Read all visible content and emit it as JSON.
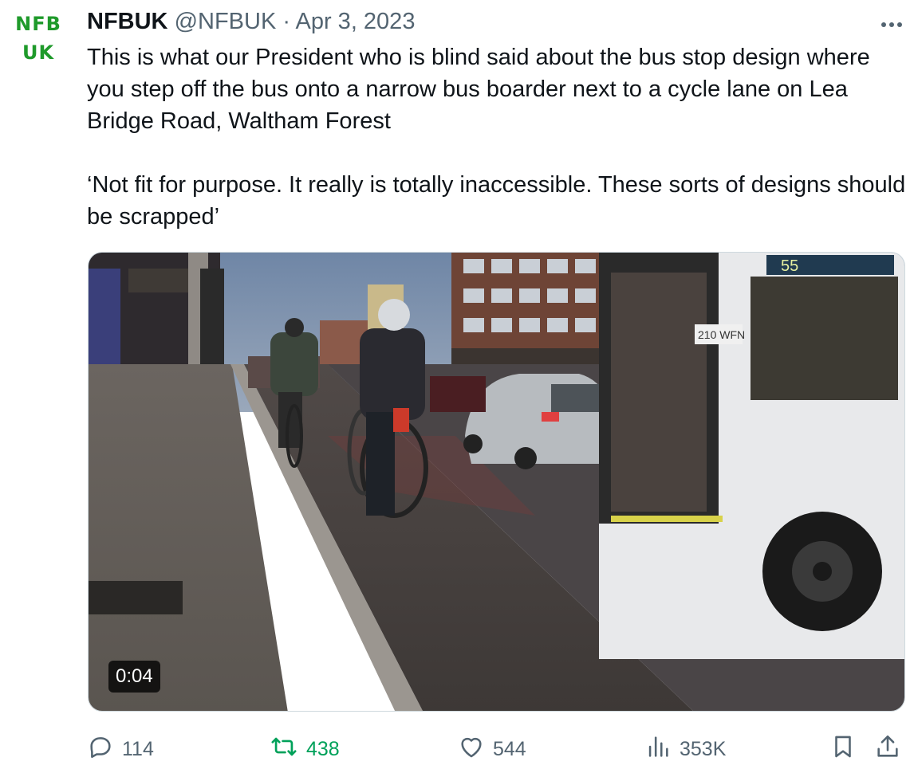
{
  "author": {
    "avatar_line1": "NFB",
    "avatar_line2": "UK",
    "name": "NFBUK",
    "handle": "@NFBUK",
    "separator": "·",
    "date": "Apr 3, 2023"
  },
  "tweet": {
    "paragraph1": "This is what our President who is blind said about the bus stop design where you step off the bus onto a narrow bus boarder next to a cycle lane on Lea Bridge Road, Waltham Forest",
    "paragraph2": "‘Not fit for purpose. It really is totally inaccessible. These sorts of designs should be scrapped’"
  },
  "media": {
    "type": "video",
    "duration": "0:04",
    "bus_route_sign": "55",
    "shop_sign": "210 WFN"
  },
  "actions": {
    "replies": "114",
    "retweets": "438",
    "likes": "544",
    "views": "353K"
  },
  "icons": {
    "more": "more-dots-icon",
    "reply": "reply-icon",
    "retweet": "retweet-icon",
    "like": "heart-icon",
    "views": "views-icon",
    "bookmark": "bookmark-icon",
    "share": "share-icon"
  },
  "colors": {
    "avatar_green": "#1f9a2b",
    "secondary_text": "#536471",
    "retweet_green": "#00a15a"
  }
}
